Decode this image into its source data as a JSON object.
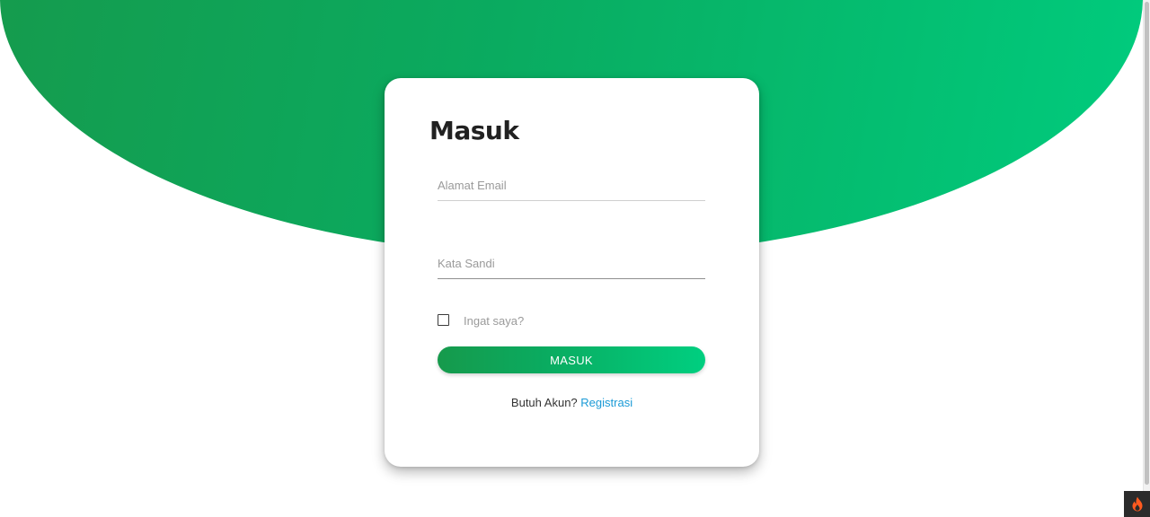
{
  "login": {
    "title": "Masuk",
    "email_placeholder": "Alamat Email",
    "password_placeholder": "Kata Sandi",
    "remember_label": "Ingat saya?",
    "remember_checked": false,
    "submit_label": "MASUK",
    "register_prompt": "Butuh Akun?",
    "register_link": "Registrasi"
  },
  "icons": {
    "toolbar": "flame-icon"
  },
  "colors": {
    "gradient_start": "#169a4c",
    "gradient_end": "#00cc7e",
    "link": "#1a9ad6",
    "toolbar_bg": "#2b2b2b",
    "flame": "#ff5a1f"
  }
}
